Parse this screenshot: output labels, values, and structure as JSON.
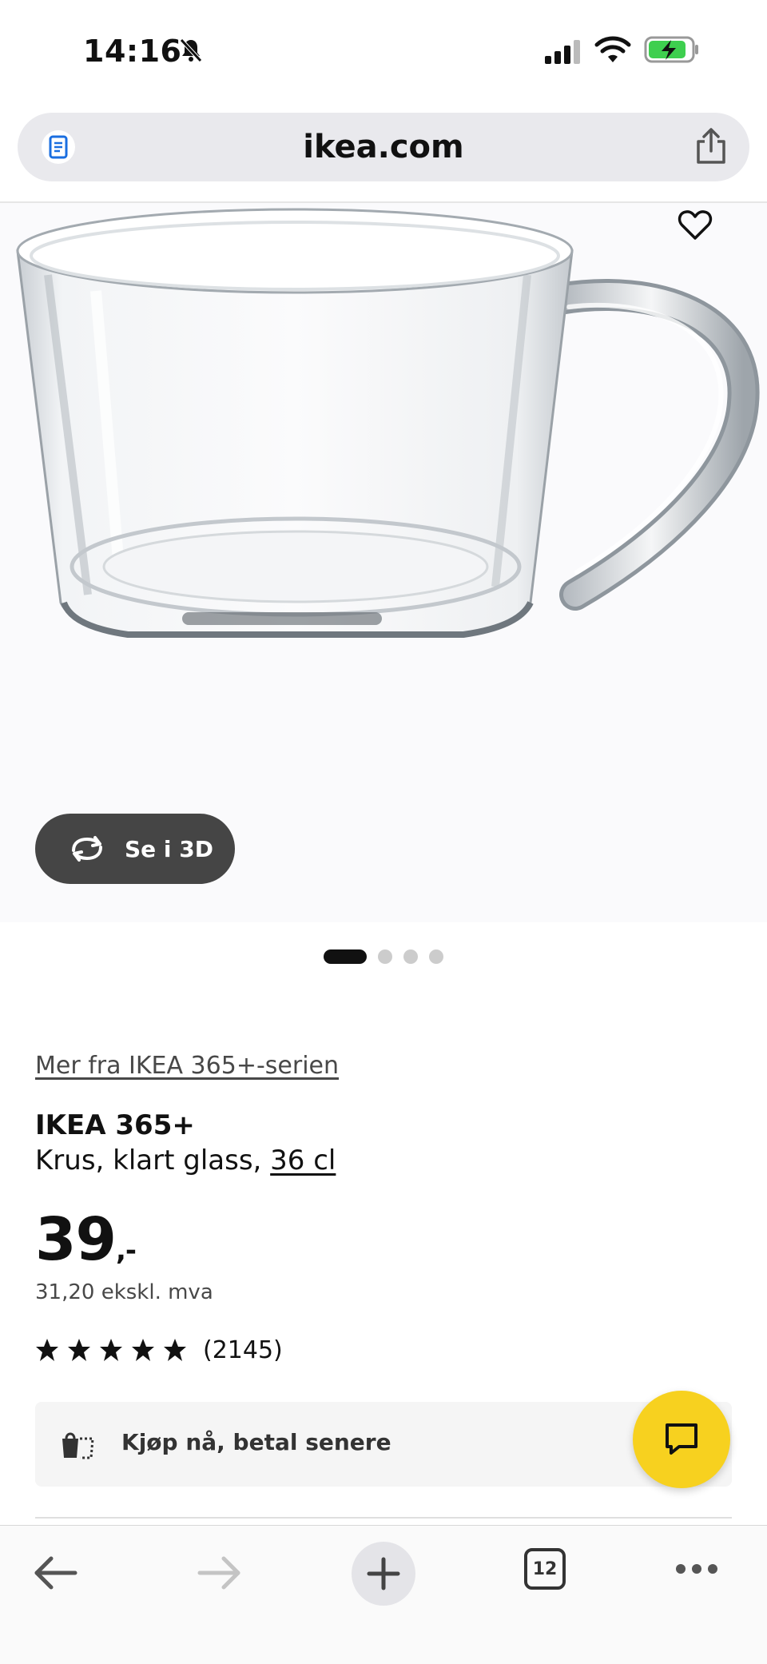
{
  "status_bar": {
    "time": "14:16"
  },
  "browser": {
    "url": "ikea.com",
    "open_tabs": "12"
  },
  "product": {
    "series_link": "Mer fra IKEA 365+-serien",
    "name": "IKEA 365+",
    "description": "Krus, klart glass, ",
    "size": "36 cl",
    "price": "39",
    "price_suffix": ",-",
    "price_ex_vat": "31,20 ekskl. mva",
    "rating": 5,
    "review_count": "(2145)",
    "view_3d_label": "Se i 3D",
    "bnpl_label": "Kjøp nå, betal senere",
    "image_pages": 4,
    "active_image": 1
  },
  "colors": {
    "accent_yellow": "#f7d11f",
    "dark_button": "#454545"
  }
}
